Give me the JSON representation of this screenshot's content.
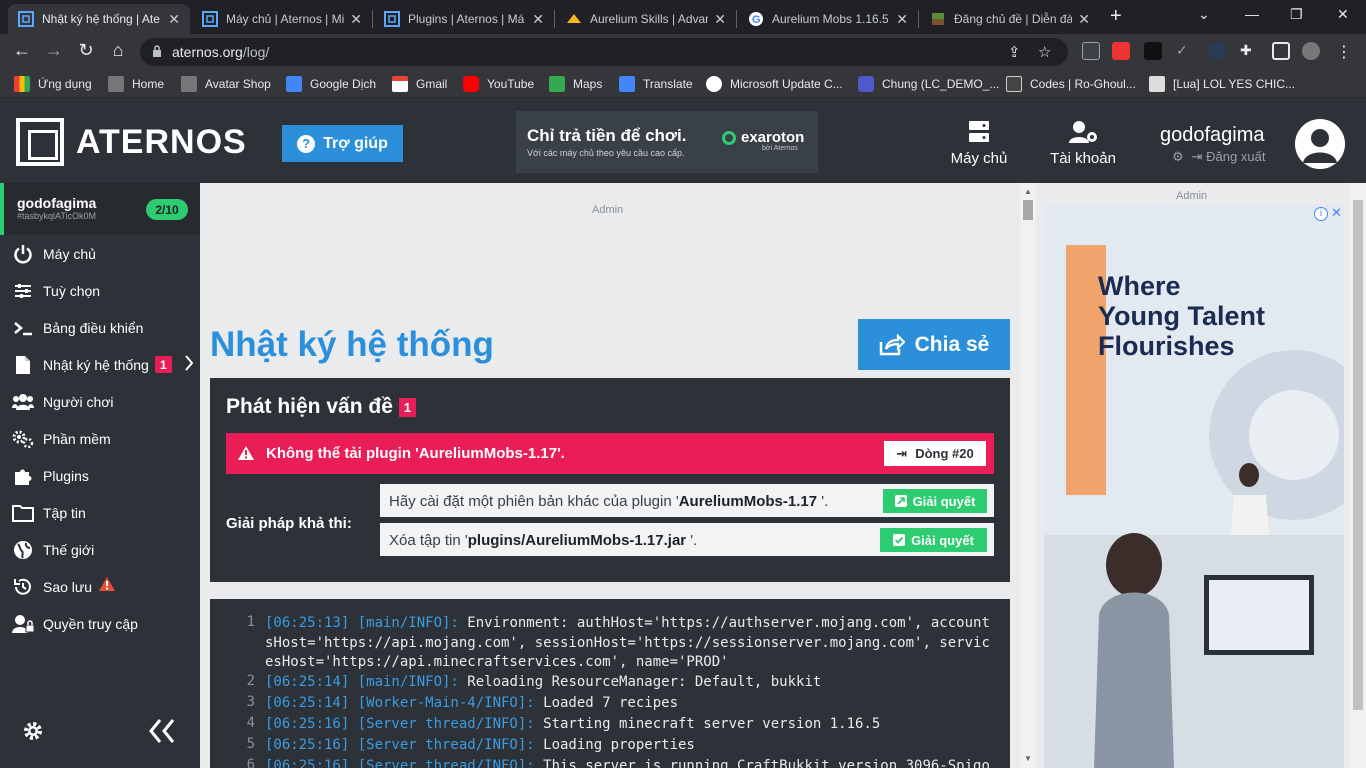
{
  "browser": {
    "tabs": [
      {
        "title": "Nhật ký hệ thống | Ate",
        "active": true
      },
      {
        "title": "Máy chủ | Aternos | Mi",
        "active": false
      },
      {
        "title": "Plugins | Aternos | Má",
        "active": false
      },
      {
        "title": "Aurelium Skills | Advar",
        "active": false
      },
      {
        "title": "Aurelium Mobs 1.16.5",
        "active": false
      },
      {
        "title": "Đăng chủ đề | Diễn đà",
        "active": false
      }
    ],
    "url_domain": "aternos.org",
    "url_path": "/log/",
    "bookmarks": [
      "Ứng dụng",
      "Home",
      "Avatar Shop",
      "Google Dịch",
      "Gmail",
      "YouTube",
      "Maps",
      "Translate",
      "Microsoft Update C...",
      "Chung (LC_DEMO_...",
      "Codes | Ro-Ghoul...",
      "[Lua] LOL YES CHIC..."
    ]
  },
  "header": {
    "logo_text": "ATERNOS",
    "help_label": "Trợ giúp",
    "promo_line1": "Chỉ trả tiền để chơi.",
    "promo_line2": "Với các máy chủ theo yêu cầu cao cấp.",
    "promo_brand": "exaroton",
    "promo_brand_sub": "bởi Aternos",
    "nav_servers": "Máy chủ",
    "nav_account": "Tài khoản",
    "username": "godofagima",
    "logout": "Đăng xuất"
  },
  "sidebar": {
    "server_name": "godofagima",
    "server_id": "#tasbykqlATicOk0M",
    "count": "2/10",
    "items": [
      {
        "label": "Máy chủ",
        "icon": "power-icon"
      },
      {
        "label": "Tuỳ chọn",
        "icon": "sliders-icon"
      },
      {
        "label": "Bảng điều khiển",
        "icon": "terminal-icon"
      },
      {
        "label": "Nhật ký hệ thống",
        "icon": "log-icon",
        "badge": "1"
      },
      {
        "label": "Người chơi",
        "icon": "players-icon"
      },
      {
        "label": "Phần mềm",
        "icon": "software-icon"
      },
      {
        "label": "Plugins",
        "icon": "puzzle-icon"
      },
      {
        "label": "Tập tin",
        "icon": "folder-icon"
      },
      {
        "label": "Thế giới",
        "icon": "globe-icon"
      },
      {
        "label": "Sao lưu",
        "icon": "backup-icon"
      },
      {
        "label": "Quyền truy cập",
        "icon": "access-icon"
      }
    ]
  },
  "main": {
    "ad_label": "Admin",
    "title": "Nhật ký hệ thống",
    "share_label": "Chia sẻ",
    "problems_heading": "Phát hiện vấn đề",
    "problems_count": "1",
    "error_text": "Không thể tải plugin 'AureliumMobs-1.17'.",
    "line_button": "Dòng #20",
    "solutions_label": "Giải pháp khả thi:",
    "solution1_pre": "Hãy cài đặt một phiên bản khác của plugin '",
    "solution1_bold": "AureliumMobs-1.17",
    "solution1_post": " '.",
    "solution2_pre": "Xóa tập tin '",
    "solution2_bold": "plugins/AureliumMobs-1.17.jar",
    "solution2_post": " '.",
    "fix_label": "Giải quyết"
  },
  "log": [
    {
      "n": "1",
      "tag": "[06:25:13] [main/INFO]:",
      "text": " Environment: authHost='https://authserver.mojang.com', accountsHost='https://api.mojang.com', sessionHost='https://sessionserver.mojang.com', servicesHost='https://api.minecraftservices.com', name='PROD'"
    },
    {
      "n": "2",
      "tag": "[06:25:14] [main/INFO]:",
      "text": " Reloading ResourceManager: Default, bukkit"
    },
    {
      "n": "3",
      "tag": "[06:25:14] [Worker-Main-4/INFO]:",
      "text": " Loaded 7 recipes"
    },
    {
      "n": "4",
      "tag": "[06:25:16] [Server thread/INFO]:",
      "text": " Starting minecraft server version 1.16.5"
    },
    {
      "n": "5",
      "tag": "[06:25:16] [Server thread/INFO]:",
      "text": " Loading properties"
    },
    {
      "n": "6",
      "tag": "[06:25:16] [Server thread/INFO]:",
      "text": " This server is running CraftBukkit version 3096-Spigo"
    }
  ],
  "right_ad": {
    "label": "Admin",
    "headline_1": "Where",
    "headline_2": "Young Talent",
    "headline_3": "Flourishes"
  }
}
